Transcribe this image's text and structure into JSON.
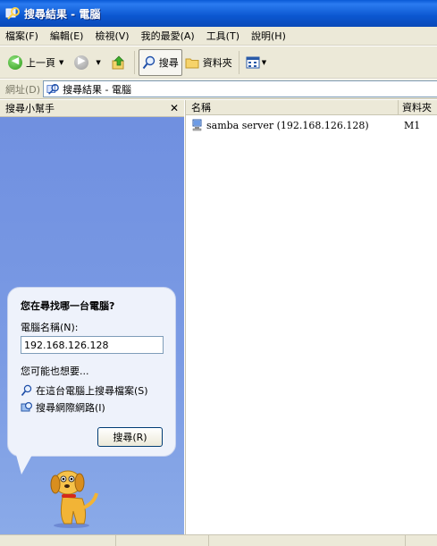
{
  "window": {
    "title": "搜尋結果 - 電腦"
  },
  "menu": [
    "檔案(F)",
    "編輯(E)",
    "檢視(V)",
    "我的最愛(A)",
    "工具(T)",
    "說明(H)"
  ],
  "toolbar": {
    "back_label": "上一頁",
    "search_label": "搜尋",
    "folders_label": "資料夾"
  },
  "address": {
    "label": "網址(D)",
    "value": "搜尋結果 - 電腦"
  },
  "pane": {
    "title": "搜尋小幫手",
    "question": "您在尋找哪一台電腦?",
    "field_label": "電腦名稱(N):",
    "field_value": "192.168.126.128",
    "also_label": "您可能也想要...",
    "links": [
      "在這台電腦上搜尋檔案(S)",
      "搜尋網際網路(I)"
    ],
    "search_button": "搜尋(R)"
  },
  "results": {
    "columns": {
      "name": "名稱",
      "folder": "資料夾"
    },
    "rows": [
      {
        "name": "samba server (192.168.126.128)",
        "folder": "M1"
      }
    ]
  },
  "colors": {
    "titlebar": "#0a5ad6",
    "pane": "#7b9be4",
    "chrome": "#ece9d8"
  },
  "icons": [
    "app-search-icon",
    "back-icon",
    "forward-icon",
    "up-folder-icon",
    "search-icon",
    "folder-icon",
    "views-icon",
    "network-computer-icon",
    "dog-assistant-icon"
  ]
}
